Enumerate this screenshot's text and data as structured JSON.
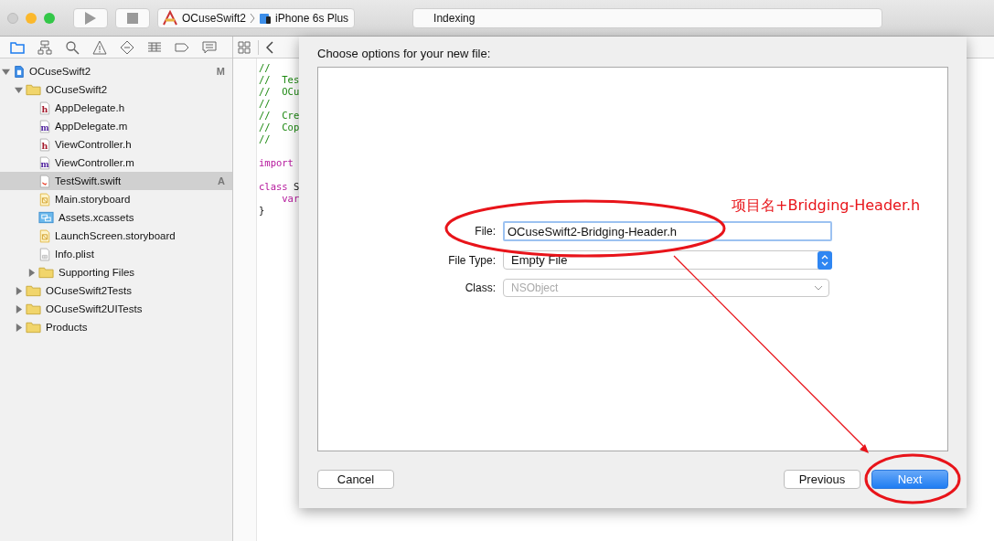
{
  "toolbar": {
    "scheme": "OCuseSwift2",
    "device": "iPhone 6s Plus",
    "activity": "Indexing"
  },
  "navigator_tabs": [
    {
      "kind": "folder",
      "selected": true
    },
    {
      "kind": "hierarchy",
      "selected": false
    },
    {
      "kind": "search",
      "selected": false
    },
    {
      "kind": "warning",
      "selected": false
    },
    {
      "kind": "test",
      "selected": false
    },
    {
      "kind": "debug",
      "selected": false
    },
    {
      "kind": "breakpoint",
      "selected": false
    },
    {
      "kind": "report",
      "selected": false
    }
  ],
  "tree": [
    {
      "name": "OCuseSwift2",
      "kind": "project",
      "badge": "M",
      "expanded": true,
      "selected": false,
      "children": [
        {
          "name": "OCuseSwift2",
          "kind": "folder",
          "expanded": true,
          "selected": false,
          "children": [
            {
              "name": "AppDelegate.h",
              "kind": "h",
              "selected": false
            },
            {
              "name": "AppDelegate.m",
              "kind": "m",
              "selected": false
            },
            {
              "name": "ViewController.h",
              "kind": "h",
              "selected": false
            },
            {
              "name": "ViewController.m",
              "kind": "m",
              "selected": false
            },
            {
              "name": "TestSwift.swift",
              "kind": "swift",
              "badge": "A",
              "selected": true
            },
            {
              "name": "Main.storyboard",
              "kind": "storyboard",
              "selected": false
            },
            {
              "name": "Assets.xcassets",
              "kind": "assets",
              "selected": false
            },
            {
              "name": "LaunchScreen.storyboard",
              "kind": "storyboard",
              "selected": false
            },
            {
              "name": "Info.plist",
              "kind": "plist",
              "selected": false
            },
            {
              "name": "Supporting Files",
              "kind": "folder",
              "expanded": false,
              "selected": false
            }
          ]
        },
        {
          "name": "OCuseSwift2Tests",
          "kind": "folder",
          "expanded": false,
          "selected": false
        },
        {
          "name": "OCuseSwift2UITests",
          "kind": "folder",
          "expanded": false,
          "selected": false
        },
        {
          "name": "Products",
          "kind": "folder",
          "expanded": false,
          "selected": false
        }
      ]
    }
  ],
  "code_lines": [
    {
      "kind": "code",
      "indent": false,
      "tokens": [
        {
          "kind": "comment",
          "text": "//"
        }
      ]
    },
    {
      "kind": "code",
      "indent": false,
      "tokens": [
        {
          "kind": "comment",
          "text": "//  Tes"
        }
      ]
    },
    {
      "kind": "code",
      "indent": false,
      "tokens": [
        {
          "kind": "comment",
          "text": "//  OCu"
        }
      ]
    },
    {
      "kind": "code",
      "indent": false,
      "tokens": [
        {
          "kind": "comment",
          "text": "//"
        }
      ]
    },
    {
      "kind": "code",
      "indent": false,
      "tokens": [
        {
          "kind": "comment",
          "text": "//  Cre"
        }
      ]
    },
    {
      "kind": "code",
      "indent": false,
      "tokens": [
        {
          "kind": "comment",
          "text": "//  Cop"
        }
      ]
    },
    {
      "kind": "code",
      "indent": false,
      "tokens": [
        {
          "kind": "comment",
          "text": "//"
        }
      ]
    },
    {
      "kind": "blank"
    },
    {
      "kind": "code",
      "indent": false,
      "tokens": [
        {
          "kind": "keyword",
          "text": "import"
        }
      ]
    },
    {
      "kind": "blank"
    },
    {
      "kind": "code",
      "indent": false,
      "tokens": [
        {
          "kind": "keyword",
          "text": "class"
        },
        {
          "kind": "plain",
          "text": " S"
        }
      ]
    },
    {
      "kind": "code",
      "indent": true,
      "tokens": [
        {
          "kind": "keyword",
          "text": "var"
        }
      ]
    },
    {
      "kind": "code",
      "indent": false,
      "tokens": [
        {
          "kind": "plain",
          "text": "}"
        }
      ]
    }
  ],
  "dialog": {
    "title": "Choose options for your new file:",
    "fields": [
      {
        "label": "File:",
        "kind": "text",
        "value": "OCuseSwift2-Bridging-Header.h",
        "disabled": false
      },
      {
        "label": "File Type:",
        "kind": "popup",
        "value": "Empty File",
        "disabled": false
      },
      {
        "label": "Class:",
        "kind": "combo",
        "value": "NSObject",
        "disabled": true
      }
    ],
    "buttons": [
      {
        "label": "Cancel",
        "default": false
      },
      {
        "label": "Previous",
        "default": false
      },
      {
        "label": "Next",
        "default": true
      }
    ]
  },
  "annotation": {
    "note": "项目名+Bridging-Header.h"
  }
}
